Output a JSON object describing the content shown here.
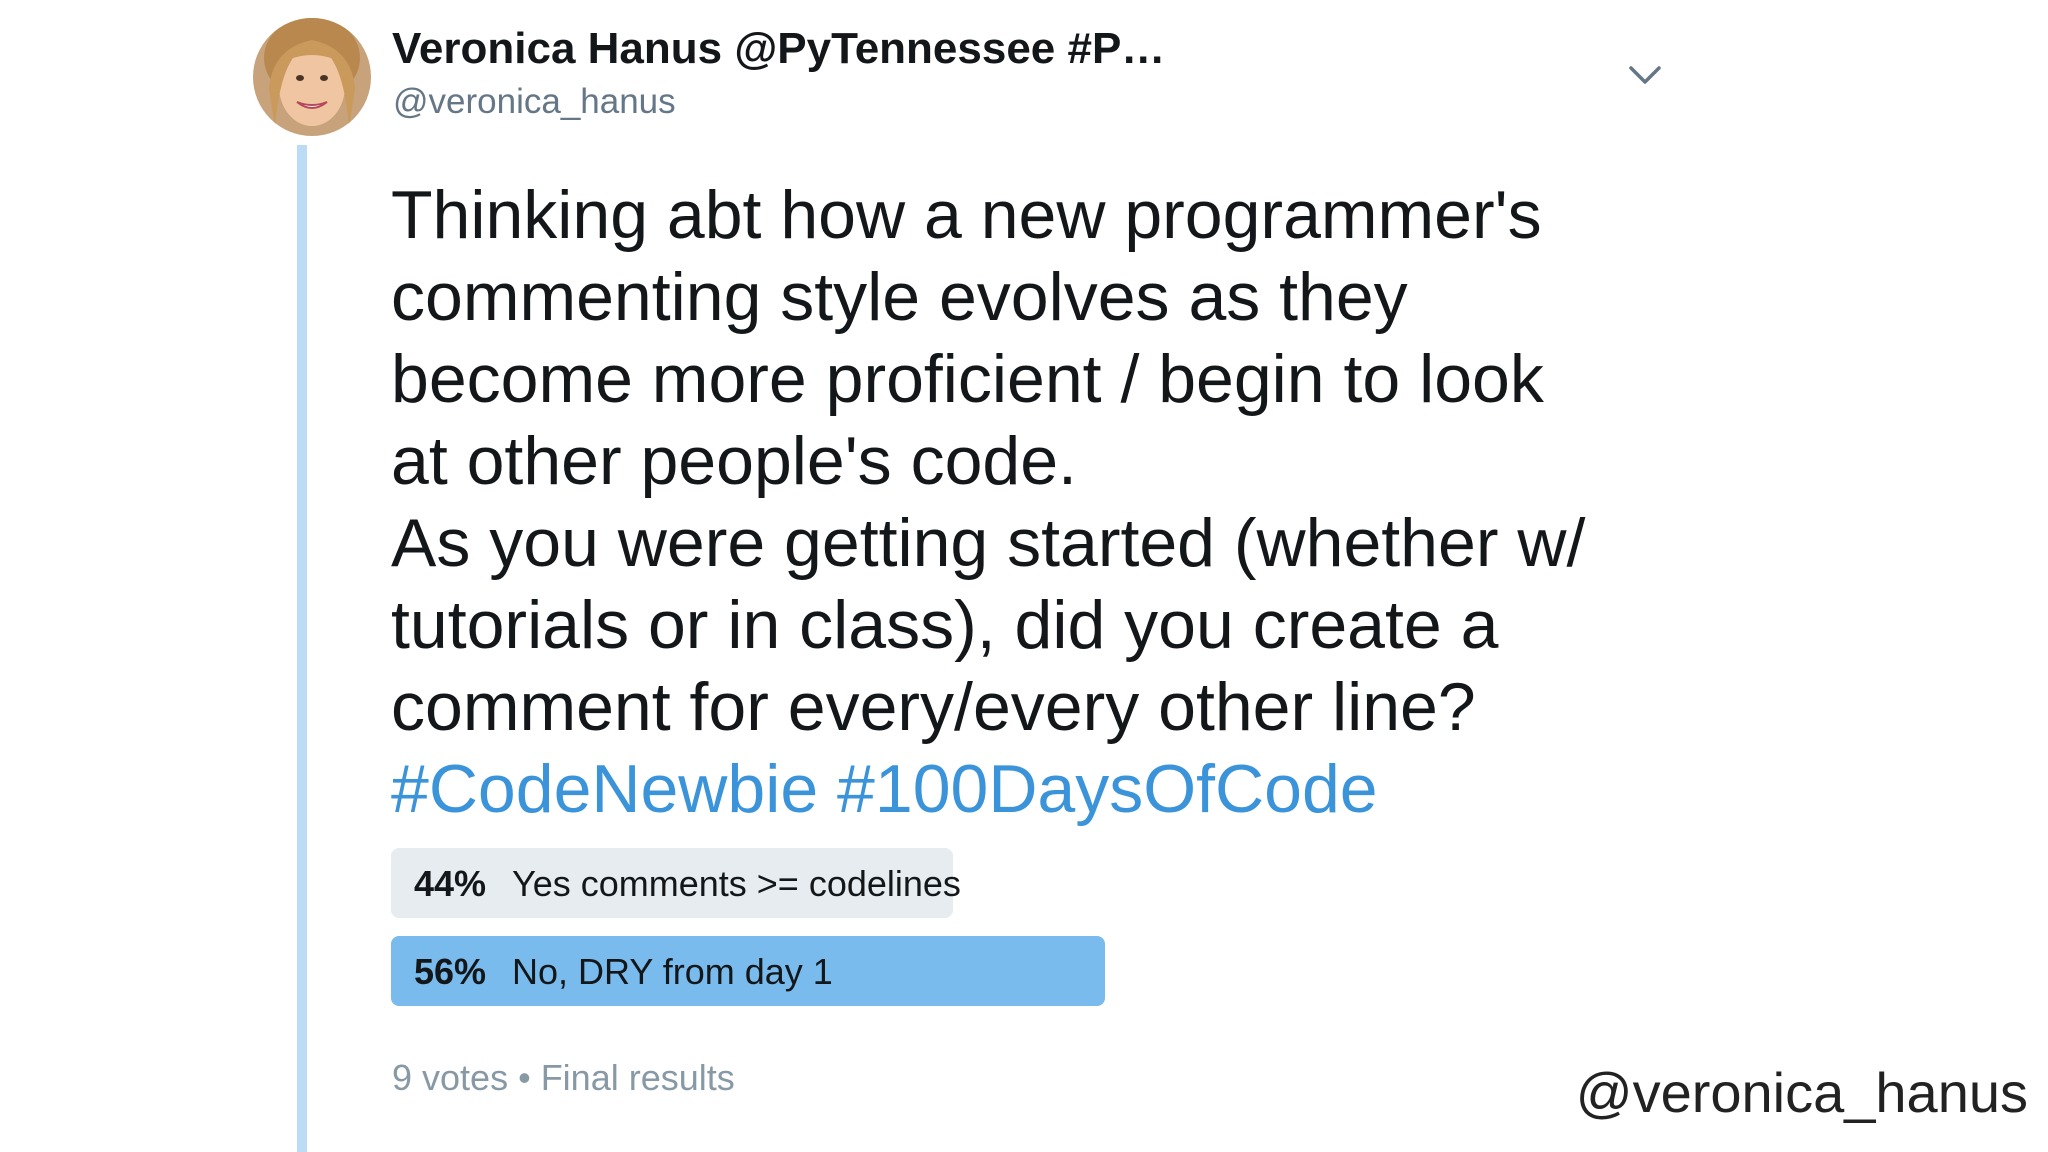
{
  "tweet": {
    "author": {
      "display_name": "Veronica Hanus @PyTennessee #P…",
      "handle": "@veronica_hanus",
      "avatar": "profile-photo"
    },
    "menu_icon": "chevron-down-icon",
    "text_lines": [
      "Thinking abt how a new programmer's",
      "commenting style evolves as they",
      "become more proficient / begin to look",
      "at other people's code.",
      "As you were getting started (whether w/",
      "tutorials or in class), did you create a",
      "comment for every/every other line?"
    ],
    "hashtags": "#CodeNewbie #100DaysOfCode",
    "poll": {
      "choices": [
        {
          "percent": "44%",
          "label": "Yes comments >= codelines",
          "share": 0.44
        },
        {
          "percent": "56%",
          "label": "No, DRY from day 1",
          "share": 0.56
        }
      ],
      "votes": "9 votes",
      "separator": "•",
      "status": "Final results"
    }
  },
  "watermark": "@veronica_hanus",
  "colors": {
    "hashtag": "#3b94d9",
    "poll_winner": "#79bbed",
    "poll_other": "#e6ecf0",
    "thread_line": "#bcdcf5",
    "secondary_text": "#657786"
  }
}
